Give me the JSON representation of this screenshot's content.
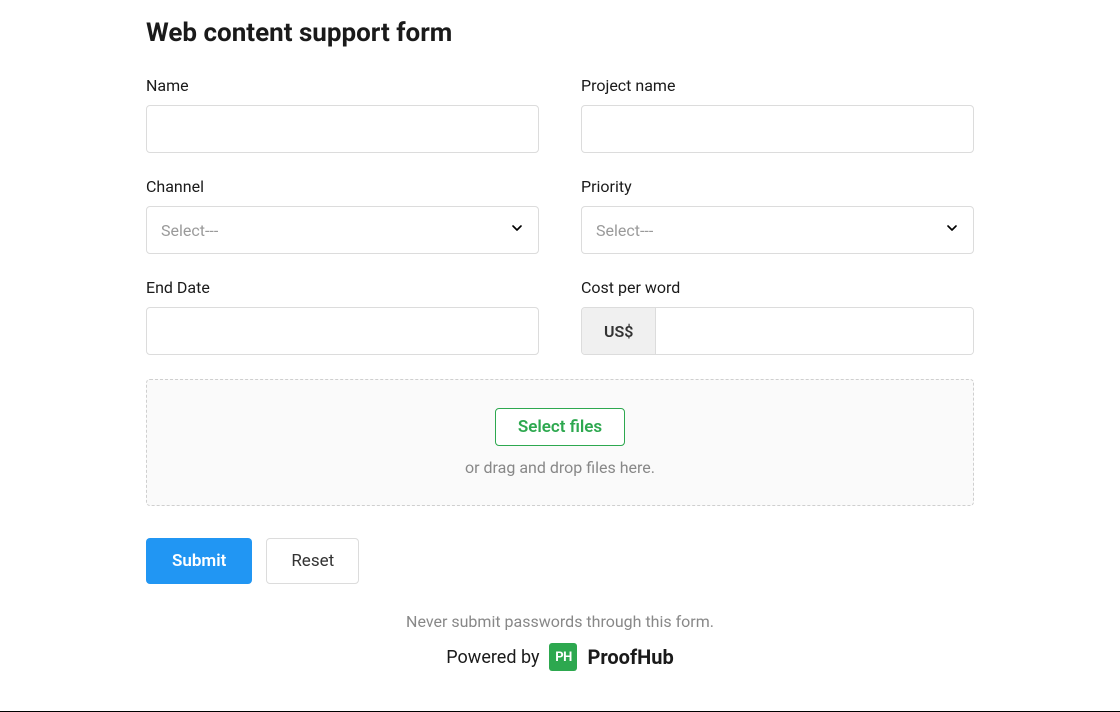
{
  "title": "Web content support form",
  "fields": {
    "name": {
      "label": "Name",
      "value": ""
    },
    "project_name": {
      "label": "Project name",
      "value": ""
    },
    "channel": {
      "label": "Channel",
      "placeholder": "Select---"
    },
    "priority": {
      "label": "Priority",
      "placeholder": "Select---"
    },
    "end_date": {
      "label": "End Date",
      "value": ""
    },
    "cost_per_word": {
      "label": "Cost per word",
      "currency_prefix": "US$",
      "value": ""
    }
  },
  "upload": {
    "button_label": "Select files",
    "hint": "or drag and drop files here."
  },
  "actions": {
    "submit_label": "Submit",
    "reset_label": "Reset"
  },
  "footer": {
    "security_note": "Never submit passwords through this form.",
    "powered_prefix": "Powered by",
    "logo_text": "PH",
    "brand_name": "ProofHub"
  }
}
